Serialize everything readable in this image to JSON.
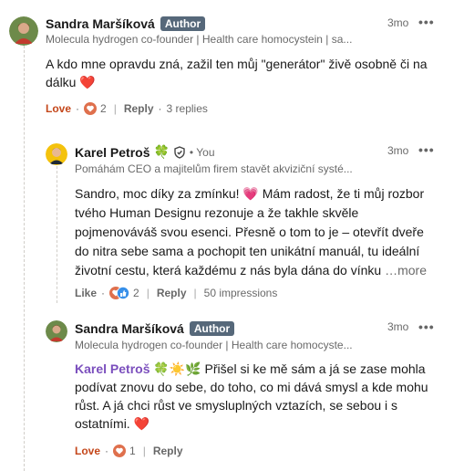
{
  "comments": [
    {
      "author": "Sandra Maršíková",
      "badge": "Author",
      "subtitle": "Molecula hydrogen co-founder | Health care homocystein | sa...",
      "time": "3mo",
      "menu": "•••",
      "text": "A kdo mne opravdu zná, zažil ten můj \"generátor\" živě osobně či na dálku",
      "emoji": "❤️",
      "reaction_label": "Love",
      "reaction_count": "2",
      "reply_label": "Reply",
      "replies_label": "3 replies",
      "separator": "·"
    },
    {
      "author": "Karel Petroš",
      "clover": "🍀",
      "you_label": "• You",
      "subtitle": "Pomáhám CEO a majitelům firem stavět akviziční systé...",
      "time": "3mo",
      "menu": "•••",
      "text_part1": "Sandro, moc díky za zmínku!",
      "emoji": "💗",
      "text_part2": " Mám radost, že ti můj rozbor tvého Human Designu rezonuje a že takhle skvěle pojmenováváš svou esenci. Přesně o tom to je – otevřít dveře do nitra sebe sama a pochopit ten unikátní manuál, tu ideální životní cestu, která každému z nás byla dána do vínku",
      "more_label": "…more",
      "reaction_label": "Like",
      "reaction_count": "2",
      "reply_label": "Reply",
      "impressions_label": "50 impressions"
    },
    {
      "author": "Sandra Maršíková",
      "badge": "Author",
      "subtitle": "Molecula hydrogen co-founder | Health care homocyste...",
      "time": "3mo",
      "menu": "•••",
      "mention": "Karel Petroš",
      "mention_emoji": "🍀☀️🌿",
      "text": " Přišel si ke mě sám a já se zase mohla podívat znovu do sebe, do toho, co mi dává smysl a kde mohu růst. A já chci růst ve smysluplných vztazích, se sebou i s ostatními.",
      "emoji": "❤️",
      "reaction_label": "Love",
      "reaction_count": "1",
      "reply_label": "Reply"
    }
  ],
  "colors": {
    "badge_bg": "#56687a",
    "love": "#c4471b",
    "mention": "#7b4fbd",
    "heart": "#e0245e"
  }
}
